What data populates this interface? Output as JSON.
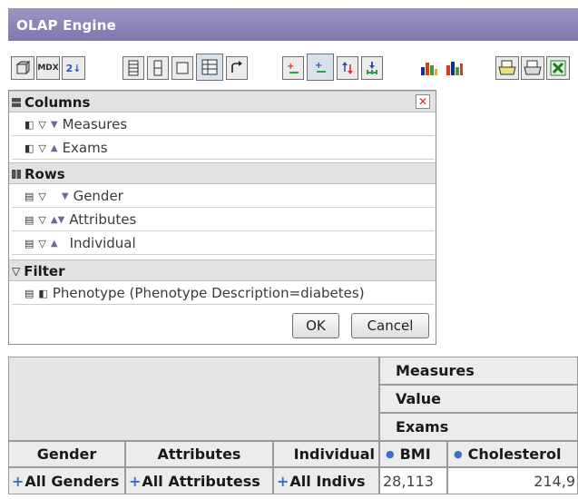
{
  "window": {
    "title": "OLAP Engine"
  },
  "toolbar": {
    "mdx_label": "MDX",
    "sort_label": "2↓",
    "icons": [
      "cube-icon",
      "mdx-icon",
      "sort-icon",
      "table-layout-icon",
      "column-layout-icon",
      "frame-icon",
      "grid-pressed-icon",
      "swap-axes-icon",
      "expand-icon",
      "drill-icon",
      "drill-down-icon",
      "hierarchy-icon",
      "bar-chart-icon",
      "stacked-chart-icon",
      "print-icon",
      "print-preview-icon",
      "excel-icon"
    ]
  },
  "panel": {
    "columns_label": "Columns",
    "columns": [
      "Measures",
      "Exams"
    ],
    "rows_label": "Rows",
    "rows": [
      "Gender",
      "Attributes",
      "Individual"
    ],
    "filter_label": "Filter",
    "filters": [
      "Phenotype (Phenotype Description=diabetes)"
    ],
    "ok_label": "OK",
    "cancel_label": "Cancel"
  },
  "grid": {
    "col_header_1": "Measures",
    "col_header_2": "Value",
    "col_header_3": "Exams",
    "row_headers": [
      "Gender",
      "Attributes",
      "Individual"
    ],
    "measures": [
      "BMI",
      "Cholesterol"
    ],
    "row": {
      "gender": "All Genders",
      "attributes": "All Attributess",
      "individual": "All Indivs",
      "bmi": "28,113",
      "cholesterol": "214,9"
    }
  },
  "colors": {
    "title_bar": "#8f88bb",
    "header_bg": "#e2e2e2",
    "accent": "#3b70c4",
    "close_red": "#cc2a2a"
  }
}
